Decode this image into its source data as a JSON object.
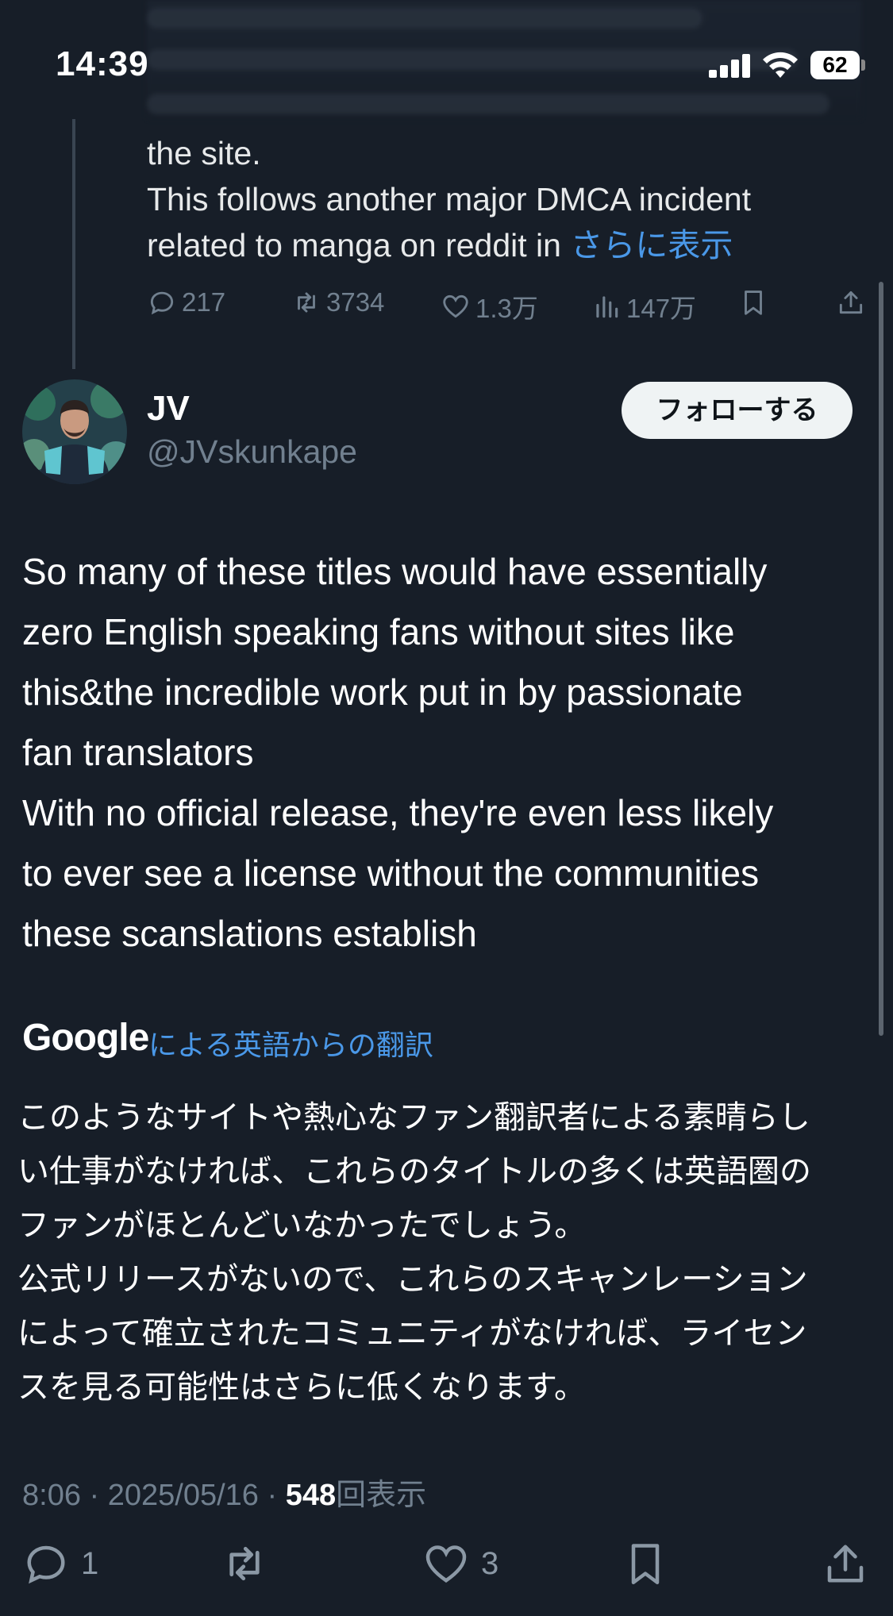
{
  "status_bar": {
    "time": "14:39",
    "battery": "62"
  },
  "parent_tweet": {
    "text_line1": "the site.",
    "text_line2": "This follows another major DMCA incident",
    "text_line3": "related to manga on reddit in ",
    "show_more": "さらに表示",
    "replies": "217",
    "reposts": "3734",
    "likes": "1.3万",
    "views": "147万"
  },
  "author": {
    "name": "JV",
    "handle": "@JVskunkape",
    "follow_label": "フォローする"
  },
  "tweet": {
    "text": "So many of these titles would have essentially\nzero English speaking fans without sites like\nthis&the incredible work put in by passionate\nfan translators\nWith no official release, they're even less likely\nto ever see a license without the communities\nthese scanslations establish"
  },
  "translation": {
    "provider": "Google",
    "label": "による英語からの翻訳",
    "text": "このようなサイトや熱心なファン翻訳者による素晴らし\nい仕事がなければ、これらのタイトルの多くは英語圏の\nファンがほとんどいなかったでしょう。\n公式リリースがないので、これらのスキャンレーション\nによって確立されたコミュニティがなければ、ライセン\nスを見る可能性はさらに低くなります。"
  },
  "meta": {
    "time": "8:06",
    "date": "2025/05/16",
    "separator": " · ",
    "views_count": "548",
    "views_label": "回表示"
  },
  "actions": {
    "replies": "1",
    "likes": "3"
  },
  "colors": {
    "background": "#171e28",
    "accent": "#4a98e8",
    "muted": "#71808f"
  }
}
